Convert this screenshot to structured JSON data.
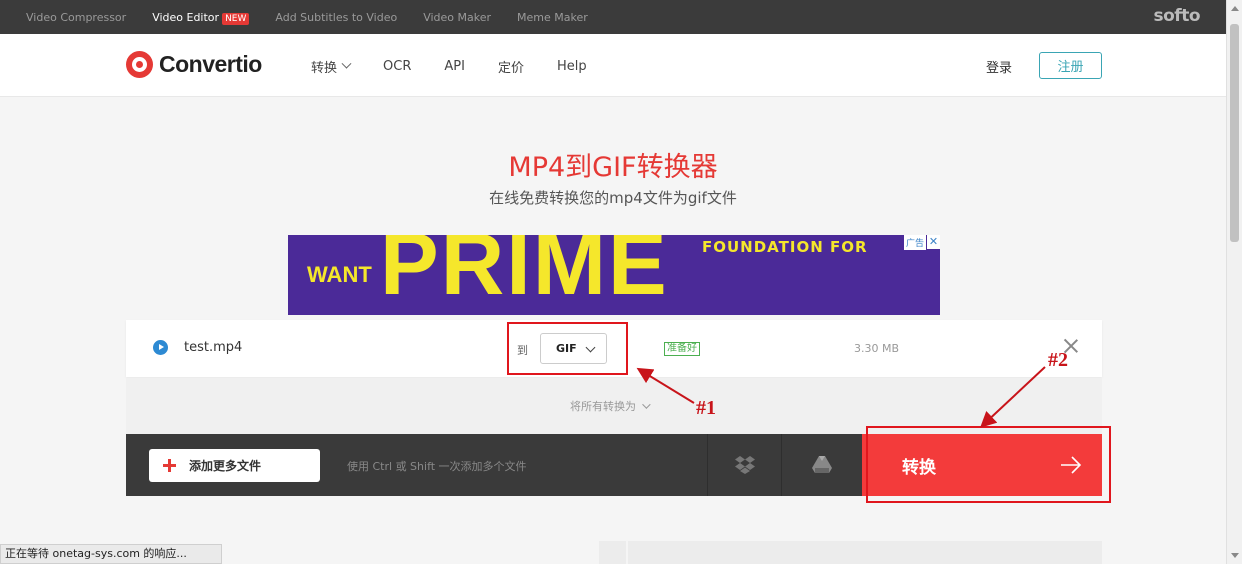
{
  "topbar": {
    "links": [
      {
        "label": "Video Compressor",
        "active": false
      },
      {
        "label": "Video Editor",
        "active": true,
        "badge": "NEW"
      },
      {
        "label": "Add Subtitles to Video",
        "active": false
      },
      {
        "label": "Video Maker",
        "active": false
      },
      {
        "label": "Meme Maker",
        "active": false
      }
    ],
    "brand": "softo"
  },
  "header": {
    "logo_text": "Convertio",
    "nav": [
      {
        "label": "转换",
        "has_dropdown": true
      },
      {
        "label": "OCR",
        "has_dropdown": false
      },
      {
        "label": "API",
        "has_dropdown": false
      },
      {
        "label": "定价",
        "has_dropdown": false
      },
      {
        "label": "Help",
        "has_dropdown": false
      }
    ],
    "login_label": "登录",
    "register_label": "注册"
  },
  "hero": {
    "title": "MP4到GIF转换器",
    "subtitle": "在线免费转换您的mp4文件为gif文件"
  },
  "ad": {
    "want": "WANT",
    "prime": "PRIME",
    "tagline": "FOUNDATION FOR",
    "badge": "广告",
    "close": "✕"
  },
  "file": {
    "name": "test.mp4",
    "to_label": "到",
    "format": "GIF",
    "status": "准备好",
    "size": "3.30 MB"
  },
  "convert_all": {
    "label": "将所有转换为"
  },
  "action_bar": {
    "add_files_label": "添加更多文件",
    "hint": "使用 Ctrl 或 Shift 一次添加多个文件",
    "convert_label": "转换"
  },
  "annotations": {
    "label1": "#1",
    "label2": "#2"
  },
  "statusbar": {
    "text": "正在等待 onetag-sys.com 的响应..."
  },
  "colors": {
    "accent_red": "#e53935",
    "convert_red": "#f33b3b",
    "annotation_red": "#e0161d",
    "register_teal": "#3aa5b4",
    "ad_purple": "#4b2a98",
    "ad_yellow": "#f5e72b"
  },
  "icons": {
    "logo": "convertio-logo-icon",
    "play": "play-circle-icon",
    "dropbox": "dropbox-icon",
    "gdrive": "google-drive-icon",
    "arrow": "arrow-right-icon",
    "close": "close-icon",
    "plus": "plus-icon"
  }
}
